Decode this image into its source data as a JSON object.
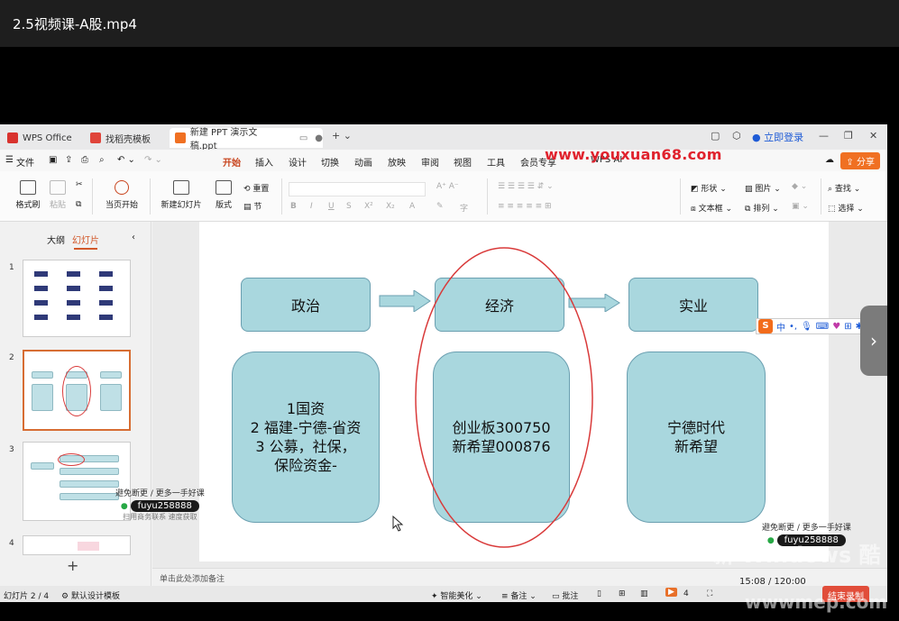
{
  "player": {
    "title": "2.5视频课-A股.mp4"
  },
  "tabs": [
    {
      "label": "WPS Office",
      "color": "#d9332e"
    },
    {
      "label": "找稻壳模板",
      "color": "#e0443a"
    },
    {
      "label": "新建 PPT 演示文稿.ppt",
      "color": "#f07022"
    }
  ],
  "window_controls": {
    "login": "立即登录"
  },
  "menu": {
    "file": "文件",
    "items": [
      "开始",
      "插入",
      "设计",
      "切换",
      "动画",
      "放映",
      "审阅",
      "视图",
      "工具",
      "会员专享",
      "WPS AI"
    ],
    "active": "开始",
    "share": "分享",
    "watermark": "www.youxuan68.com"
  },
  "ribbon": {
    "format_painter": "格式刷",
    "paste": "粘贴",
    "cut_icon": "scissors-icon",
    "play_from_current": "当页开始",
    "new_slide": "新建幻灯片",
    "layout": "版式",
    "section": "节",
    "reset": "重置",
    "shape": "形状",
    "picture": "图片",
    "textbox": "文本框",
    "arrange": "排列",
    "find": "查找",
    "select": "选择"
  },
  "left_panel": {
    "tabs": [
      "大纲",
      "幻灯片"
    ],
    "active_tab": "幻灯片",
    "slide_numbers": [
      "1",
      "2",
      "3",
      "4"
    ]
  },
  "slide": {
    "top_boxes": [
      "政治",
      "经济",
      "实业"
    ],
    "bottom_boxes": [
      [
        "1国资",
        "2 福建-宁德-省资",
        "3 公募，社保，",
        "保险资金-"
      ],
      [
        "创业板300750",
        "新希望000876"
      ],
      [
        "宁德时代",
        "新希望"
      ]
    ],
    "colors": {
      "box_fill": "#a9d7de",
      "box_border": "#6a9fb0",
      "circle": "#d93a3a"
    }
  },
  "notes_placeholder": "单击此处添加备注",
  "status": {
    "slide_index": "幻灯片 2 / 4",
    "template": "默认设计模板",
    "beautify": "智能美化",
    "notes": "备注",
    "comments": "批注",
    "zoom": "4",
    "end_record": "结束录制"
  },
  "overlays": {
    "wm_left_line1": "避免断更 / 更多一手好课",
    "wm_left_pill": "fuyu258888",
    "wm_left_line2": "扫用商务联系 速度获取",
    "wm_right_line1": "避免断更 / 更多一手好课",
    "wm_right_pill": "fuyu258888",
    "ime_logo": "S",
    "ime_mode": "中",
    "timer": "15:08 / 120:00",
    "corner_watermark": "新 Windows 酷",
    "corner_url": "wwwmep.com"
  }
}
